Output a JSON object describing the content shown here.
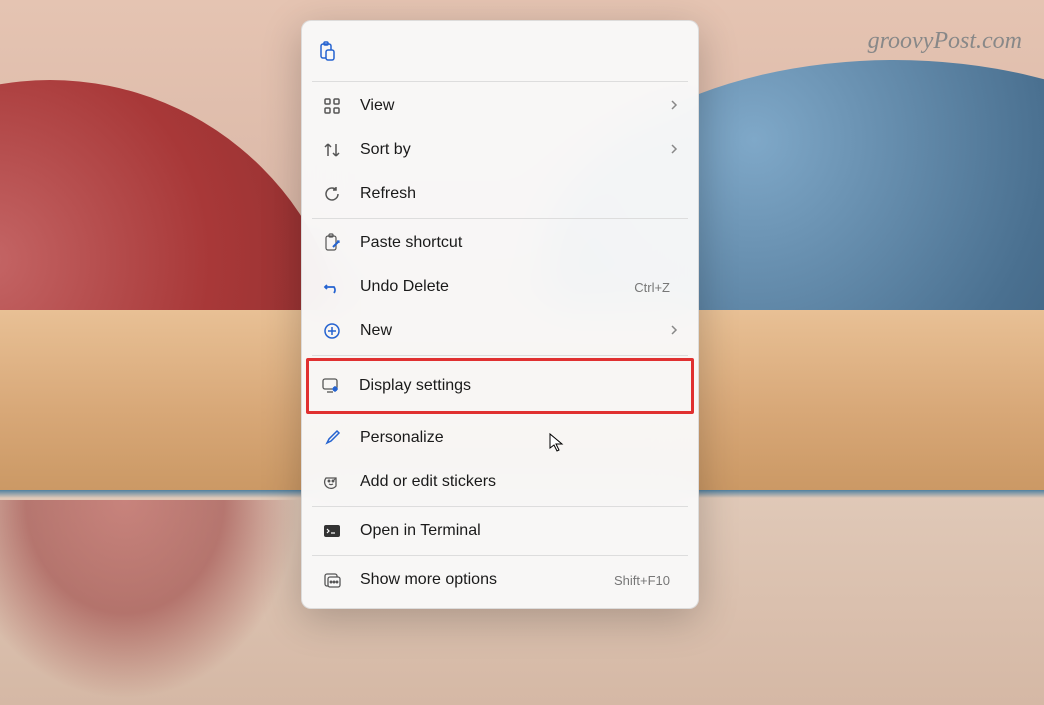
{
  "watermark": "groovyPost.com",
  "menu": {
    "topIcons": {
      "paste": "paste"
    },
    "view": {
      "label": "View",
      "hasSubmenu": true
    },
    "sortBy": {
      "label": "Sort by",
      "hasSubmenu": true
    },
    "refresh": {
      "label": "Refresh"
    },
    "pasteShortcut": {
      "label": "Paste shortcut"
    },
    "undoDelete": {
      "label": "Undo Delete",
      "shortcut": "Ctrl+Z"
    },
    "new": {
      "label": "New",
      "hasSubmenu": true
    },
    "displaySettings": {
      "label": "Display settings"
    },
    "personalize": {
      "label": "Personalize"
    },
    "addStickers": {
      "label": "Add or edit stickers"
    },
    "openTerminal": {
      "label": "Open in Terminal"
    },
    "showMore": {
      "label": "Show more options",
      "shortcut": "Shift+F10"
    }
  }
}
